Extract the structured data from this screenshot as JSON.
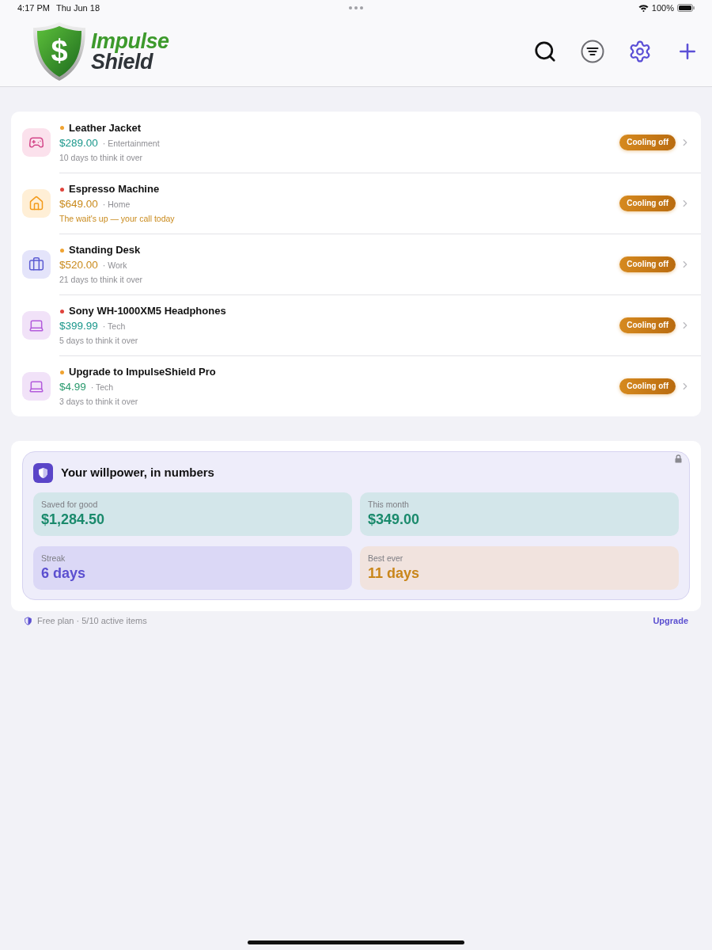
{
  "status_bar": {
    "time": "4:17 PM",
    "date": "Thu Jun 18",
    "battery": "100%"
  },
  "header": {
    "logo": {
      "symbol": "$",
      "line_1": "Impulse",
      "line_2": "Shield"
    }
  },
  "items": [
    {
      "kind": "entertainment",
      "color": "#f0a331",
      "name": "Leather Jacket",
      "price": {
        "text": "$289.00",
        "color": "#1a978b"
      },
      "category": "· Entertainment",
      "note": "10 days to think it over",
      "urgent": false,
      "badge": "Cooling off"
    },
    {
      "kind": "home",
      "color": "#e0443c",
      "name": "Espresso Machine",
      "price": {
        "text": "$649.00",
        "color": "#c98a1c"
      },
      "category": "· Home",
      "note": "The wait's up — your call today",
      "urgent": true,
      "badge": "Cooling off"
    },
    {
      "kind": "work",
      "color": "#f0a331",
      "name": "Standing Desk",
      "price": {
        "text": "$520.00",
        "color": "#c98a1c"
      },
      "category": "· Work",
      "note": "21 days to think it over",
      "urgent": false,
      "badge": "Cooling off"
    },
    {
      "kind": "tech",
      "color": "#e0443c",
      "name": "Sony WH-1000XM5 Headphones",
      "price": {
        "text": "$399.99",
        "color": "#1a978b"
      },
      "category": "· Tech",
      "note": "5 days to think it over",
      "urgent": false,
      "badge": "Cooling off"
    },
    {
      "kind": "tech",
      "color": "#f0a331",
      "name": "Upgrade to ImpulseShield Pro",
      "price": {
        "text": "$4.99",
        "color": "#2a9a6e"
      },
      "category": "· Tech",
      "note": "3 days to think it over",
      "urgent": false,
      "badge": "Cooling off"
    }
  ],
  "stats": {
    "title": "Your willpower, in numbers",
    "locked": true,
    "tiles": [
      {
        "color": "#d3e6ea",
        "label": "Saved for good",
        "value": {
          "text": "$1,284.50",
          "color": "#1a8a6c"
        }
      },
      {
        "color": "#d3e6ea",
        "label": "This month",
        "value": {
          "text": "$349.00",
          "color": "#1a8a6c"
        }
      },
      {
        "color": "#dbd8f6",
        "label": "Streak",
        "value": {
          "text": "6 days",
          "color": "#5b4fd0"
        }
      },
      {
        "color": "#f1e3de",
        "label": "Best ever",
        "value": {
          "text": "11 days",
          "color": "#c9861a"
        }
      }
    ]
  },
  "footer": {
    "plan": "Free plan · 5/10 active items",
    "action": "Upgrade"
  }
}
